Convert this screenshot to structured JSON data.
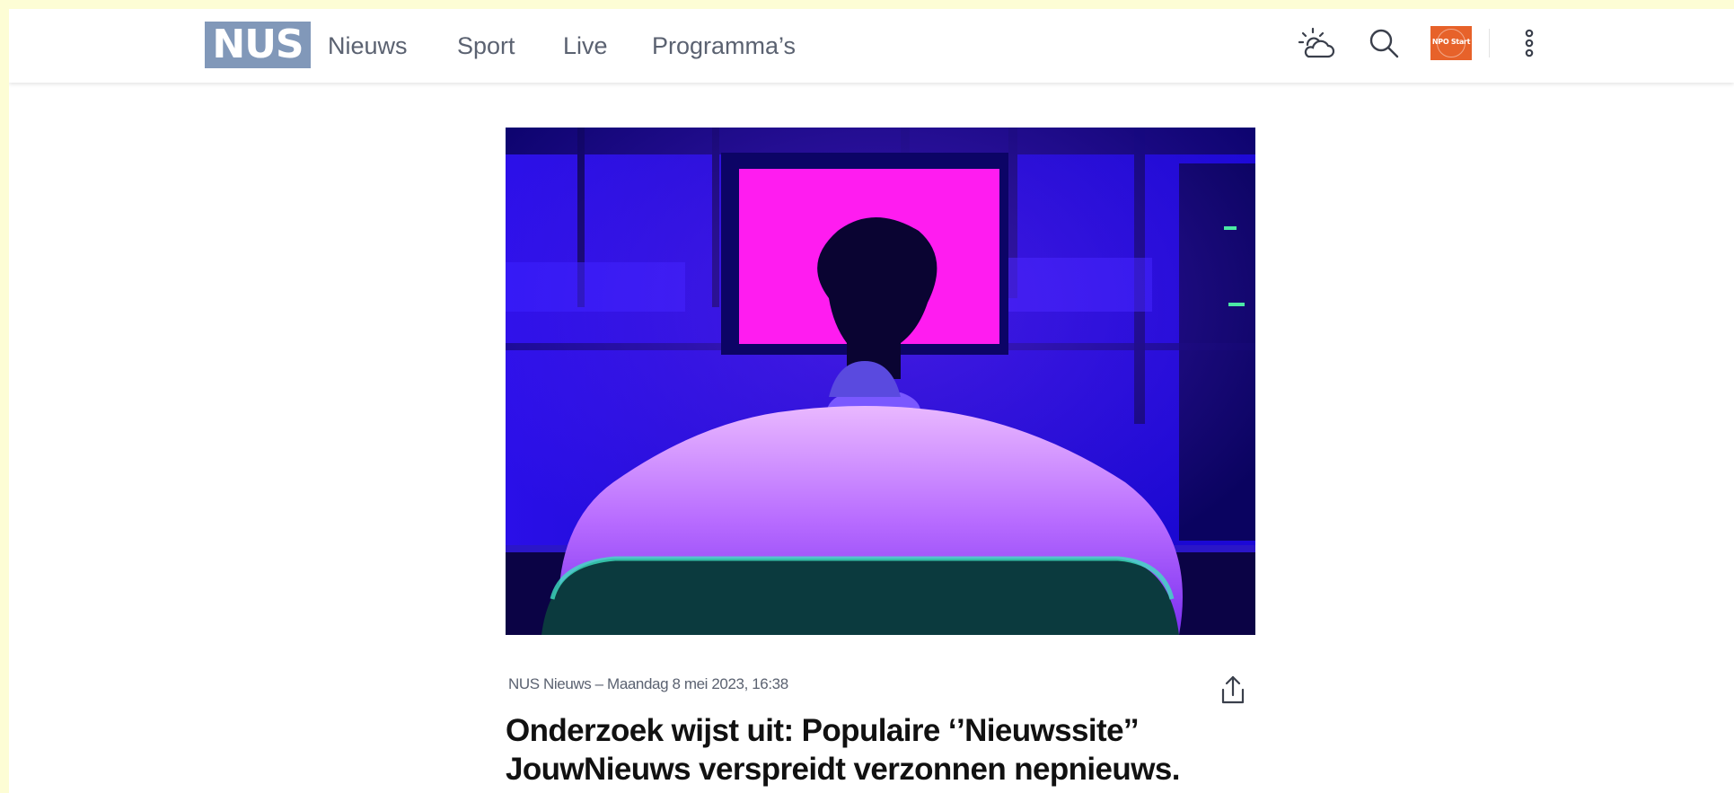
{
  "header": {
    "logo_text": "NUS",
    "nav": {
      "nieuws": "Nieuws",
      "sport": "Sport",
      "live": "Live",
      "programmas": "Programma’s"
    },
    "npo_start_label": "NPO Start",
    "icons": [
      "weather-icon",
      "search-icon",
      "more-vertical-icon"
    ],
    "colors": {
      "logo_bg": "#8198b9",
      "npo_bg": "#e7622a",
      "nav_text": "#5b6271"
    }
  },
  "article": {
    "meta": "NUS Nieuws – Maandag 8 mei 2023, 16:38",
    "headline_line1": "Onderzoek wijst uit: Populaire ‘’Nieuwssite’’",
    "headline_line2": "JouwNieuws verspreidt verzonnen nepnieuws.",
    "share_icon": "share-icon"
  },
  "colors": {
    "page_border": "#fdfdd5",
    "hero_blue": "#1d0ad9",
    "hero_magenta": "#ff1cf0"
  }
}
